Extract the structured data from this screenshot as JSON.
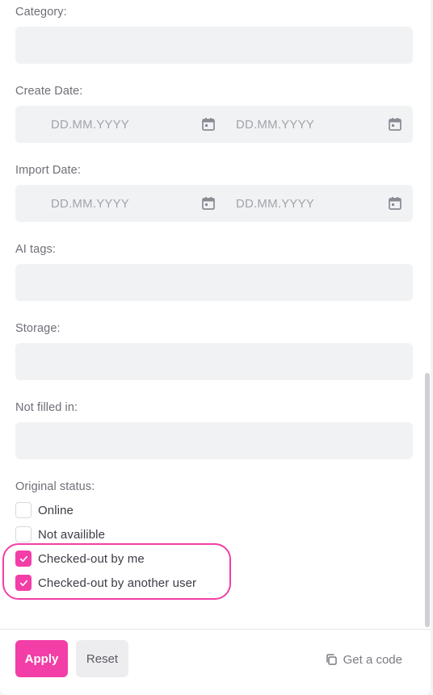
{
  "fields": {
    "category": {
      "label": "Category:"
    },
    "create_date": {
      "label": "Create Date:",
      "from_placeholder": "DD.MM.YYYY",
      "to_placeholder": "DD.MM.YYYY"
    },
    "import_date": {
      "label": "Import Date:",
      "from_placeholder": "DD.MM.YYYY",
      "to_placeholder": "DD.MM.YYYY"
    },
    "ai_tags": {
      "label": "AI tags:"
    },
    "storage": {
      "label": "Storage:"
    },
    "not_filled_in": {
      "label": "Not filled in:"
    }
  },
  "original_status": {
    "label": "Original status:",
    "options": [
      {
        "label": "Online",
        "checked": false
      },
      {
        "label": "Not availible",
        "checked": false
      },
      {
        "label": "Checked-out by me",
        "checked": true
      },
      {
        "label": "Checked-out by another user",
        "checked": true
      }
    ]
  },
  "footer": {
    "apply_label": "Apply",
    "reset_label": "Reset",
    "get_code_label": "Get a code"
  },
  "colors": {
    "accent": "#f23ea6",
    "field_bg": "#f1f2f4"
  },
  "icons": {
    "calendar": "calendar-icon",
    "checkmark": "checkmark-icon",
    "copy": "copy-icon"
  }
}
